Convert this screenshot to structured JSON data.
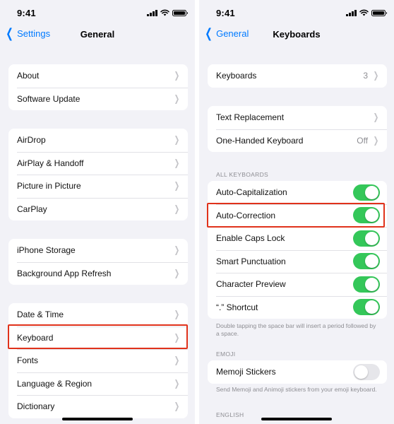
{
  "left": {
    "status": {
      "time": "9:41"
    },
    "nav": {
      "back_label": "Settings",
      "title": "General"
    },
    "group1": [
      {
        "label": "About"
      },
      {
        "label": "Software Update"
      }
    ],
    "group2": [
      {
        "label": "AirDrop"
      },
      {
        "label": "AirPlay & Handoff"
      },
      {
        "label": "Picture in Picture"
      },
      {
        "label": "CarPlay"
      }
    ],
    "group3": [
      {
        "label": "iPhone Storage"
      },
      {
        "label": "Background App Refresh"
      }
    ],
    "group4": [
      {
        "label": "Date & Time"
      },
      {
        "label": "Keyboard"
      },
      {
        "label": "Fonts"
      },
      {
        "label": "Language & Region"
      },
      {
        "label": "Dictionary"
      }
    ]
  },
  "right": {
    "status": {
      "time": "9:41"
    },
    "nav": {
      "back_label": "General",
      "title": "Keyboards"
    },
    "group1": [
      {
        "label": "Keyboards",
        "value": "3"
      }
    ],
    "group2": [
      {
        "label": "Text Replacement",
        "value": ""
      },
      {
        "label": "One-Handed Keyboard",
        "value": "Off"
      }
    ],
    "all_keyboards_header": "ALL KEYBOARDS",
    "toggles": [
      {
        "label": "Auto-Capitalization",
        "on": true
      },
      {
        "label": "Auto-Correction",
        "on": true
      },
      {
        "label": "Enable Caps Lock",
        "on": true
      },
      {
        "label": "Smart Punctuation",
        "on": true
      },
      {
        "label": "Character Preview",
        "on": true
      },
      {
        "label": "“.” Shortcut",
        "on": true
      }
    ],
    "shortcut_footnote": "Double tapping the space bar will insert a period followed by a space.",
    "emoji_header": "EMOJI",
    "emoji_toggles": [
      {
        "label": "Memoji Stickers",
        "on": false
      }
    ],
    "emoji_footnote": "Send Memoji and Animoji stickers from your emoji keyboard.",
    "english_header": "ENGLISH"
  },
  "colors": {
    "accent": "#007aff",
    "toggle_on": "#34c759",
    "highlight": "#e0321b",
    "background": "#f2f2f7"
  },
  "icons": {
    "back": "chevron-left-icon",
    "disclosure": "chevron-right-icon",
    "signal": "cellular-signal-icon",
    "wifi": "wifi-icon",
    "battery": "battery-icon"
  }
}
